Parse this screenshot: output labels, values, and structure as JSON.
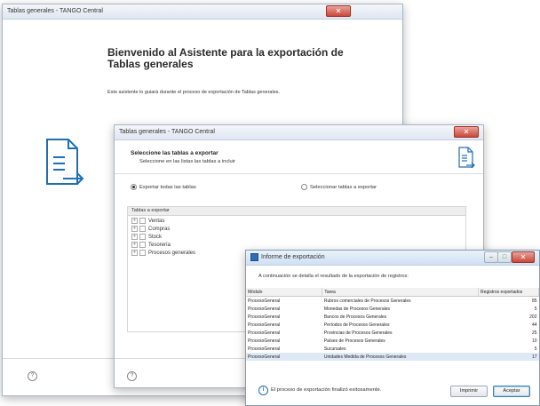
{
  "window1": {
    "title": "Tablas generales - TANGO Central",
    "close": "✕",
    "heading": "Bienvenido al Asistente para la exportación de Tablas generales",
    "body": "Este asistente lo guiará durante el proceso de exportación de Tablas generales.",
    "help_icon": "?"
  },
  "window2": {
    "title": "Tablas generales - TANGO Central",
    "close": "✕",
    "heading": "Seleccione las tablas a exportar",
    "subheading": "Seleccione en las listas las tablas a incluir",
    "radio_all": "Exportar todas las tablas",
    "radio_select": "Seleccionar tablas a exportar",
    "tree_header": "Tablas a exportar",
    "tree_items": [
      "Ventas",
      "Compras",
      "Stock",
      "Tesorería",
      "Procesos generales"
    ],
    "help_icon": "?"
  },
  "window3": {
    "title": "Informe de exportación",
    "minimize": "–",
    "maximize": "□",
    "close": "✕",
    "intro": "A continuación se detalla el resultado de la exportación de registros:",
    "columns": [
      "Módulo",
      "Tarea",
      "Registros exportados"
    ],
    "rows": [
      [
        "ProcesoGeneral",
        "Rubros comerciales de Procesos Generales",
        "85"
      ],
      [
        "ProcesoGeneral",
        "Monedas de Procesos Generales",
        "5"
      ],
      [
        "ProcesoGeneral",
        "Bancos de Procesos Generales",
        "202"
      ],
      [
        "ProcesoGeneral",
        "Períodos de Procesos Generales",
        "44"
      ],
      [
        "ProcesoGeneral",
        "Provincias de Procesos Generales",
        "25"
      ],
      [
        "ProcesoGeneral",
        "Países de Procesos Generales",
        "10"
      ],
      [
        "ProcesoGeneral",
        "Sucursales",
        "5"
      ],
      [
        "ProcesoGeneral",
        "Unidades Medida de Procesos Generales",
        "17"
      ]
    ],
    "status": "El proceso de exportación finalizó exitosamente.",
    "print_button": "Imprimir",
    "accept_button": "Aceptar"
  },
  "colors": {
    "accent": "#1f6fb3",
    "title_bar": "#dfe7f1",
    "close_red": "#c9483a",
    "status_icon": "#1f6fb3"
  }
}
